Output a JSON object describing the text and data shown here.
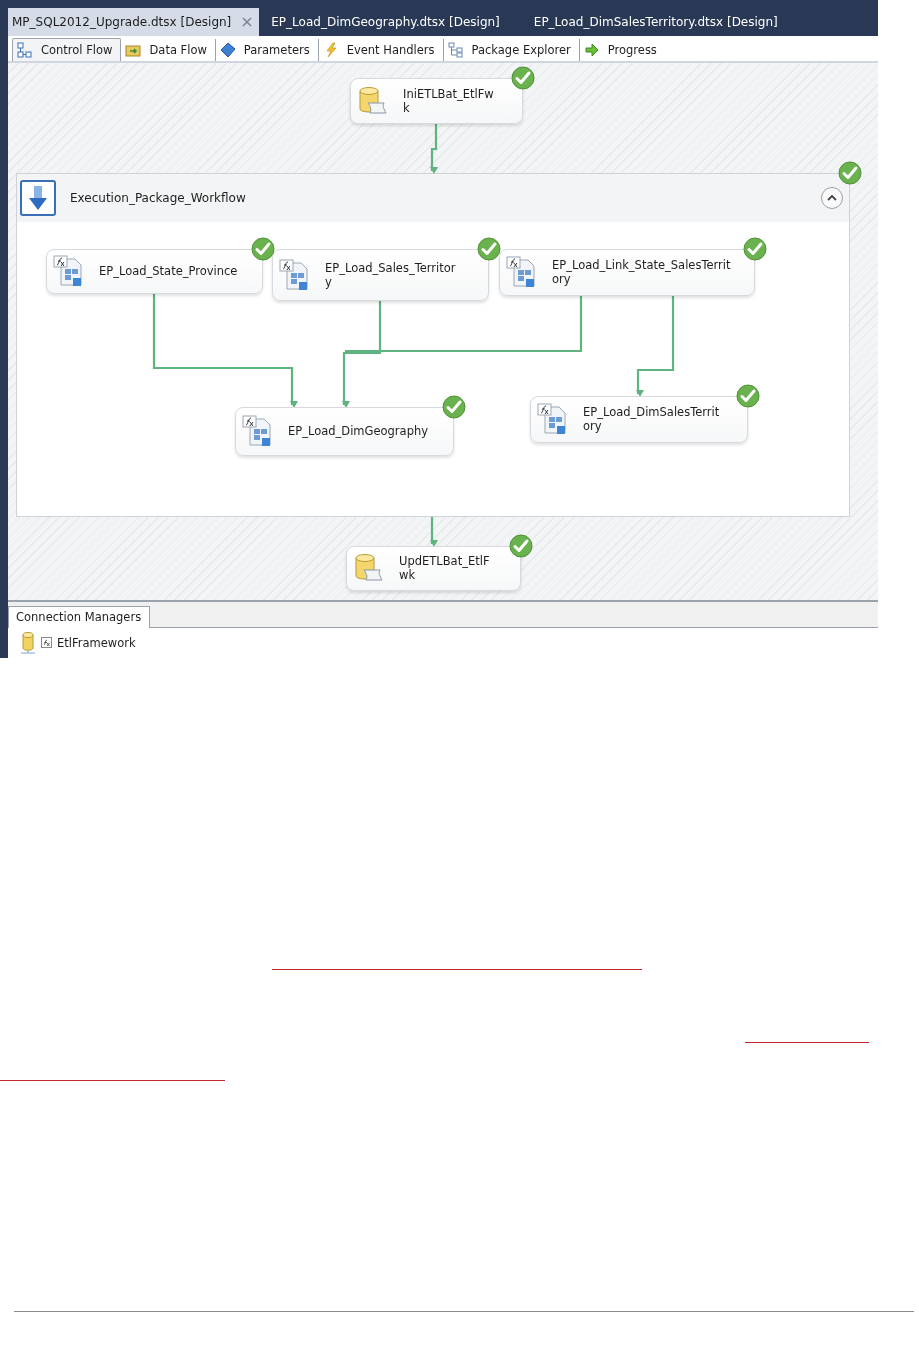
{
  "document_tabs": [
    {
      "label": "MP_SQL2012_Upgrade.dtsx [Design]",
      "selected": true
    },
    {
      "label": "EP_Load_DimGeography.dtsx [Design]",
      "selected": false
    },
    {
      "label": "EP_Load_DimSalesTerritory.dtsx [Design]",
      "selected": false
    }
  ],
  "designer_tabs": [
    {
      "label": "Control Flow",
      "selected": true
    },
    {
      "label": "Data Flow",
      "selected": false
    },
    {
      "label": "Parameters",
      "selected": false
    },
    {
      "label": "Event Handlers",
      "selected": false
    },
    {
      "label": "Package Explorer",
      "selected": false
    },
    {
      "label": "Progress",
      "selected": false
    }
  ],
  "control_flow": {
    "nodes": [
      {
        "kind": "script",
        "label": "IniETLBat_EtlFw\nk",
        "succeeded": true
      },
      {
        "kind": "container",
        "title": "Execution_Package_Workflow",
        "succeeded": true,
        "expanded": true,
        "children": [
          {
            "kind": "package",
            "label": "EP_Load_State_Province",
            "succeeded": true
          },
          {
            "kind": "package",
            "label": "EP_Load_Sales_Territor\ny",
            "succeeded": true
          },
          {
            "kind": "package",
            "label": "EP_Load_Link_State_SalesTerrit\nory",
            "succeeded": true
          },
          {
            "kind": "package",
            "label": "EP_Load_DimGeography",
            "succeeded": true
          },
          {
            "kind": "package",
            "label": "EP_Load_DimSalesTerrit\nory",
            "succeeded": true
          }
        ]
      },
      {
        "kind": "script",
        "label": "UpdETLBat_EtlF\nwk",
        "succeeded": true
      }
    ]
  },
  "connection_managers": {
    "tab": "Connection Managers",
    "items": [
      {
        "label": "EtlFramework"
      }
    ]
  }
}
